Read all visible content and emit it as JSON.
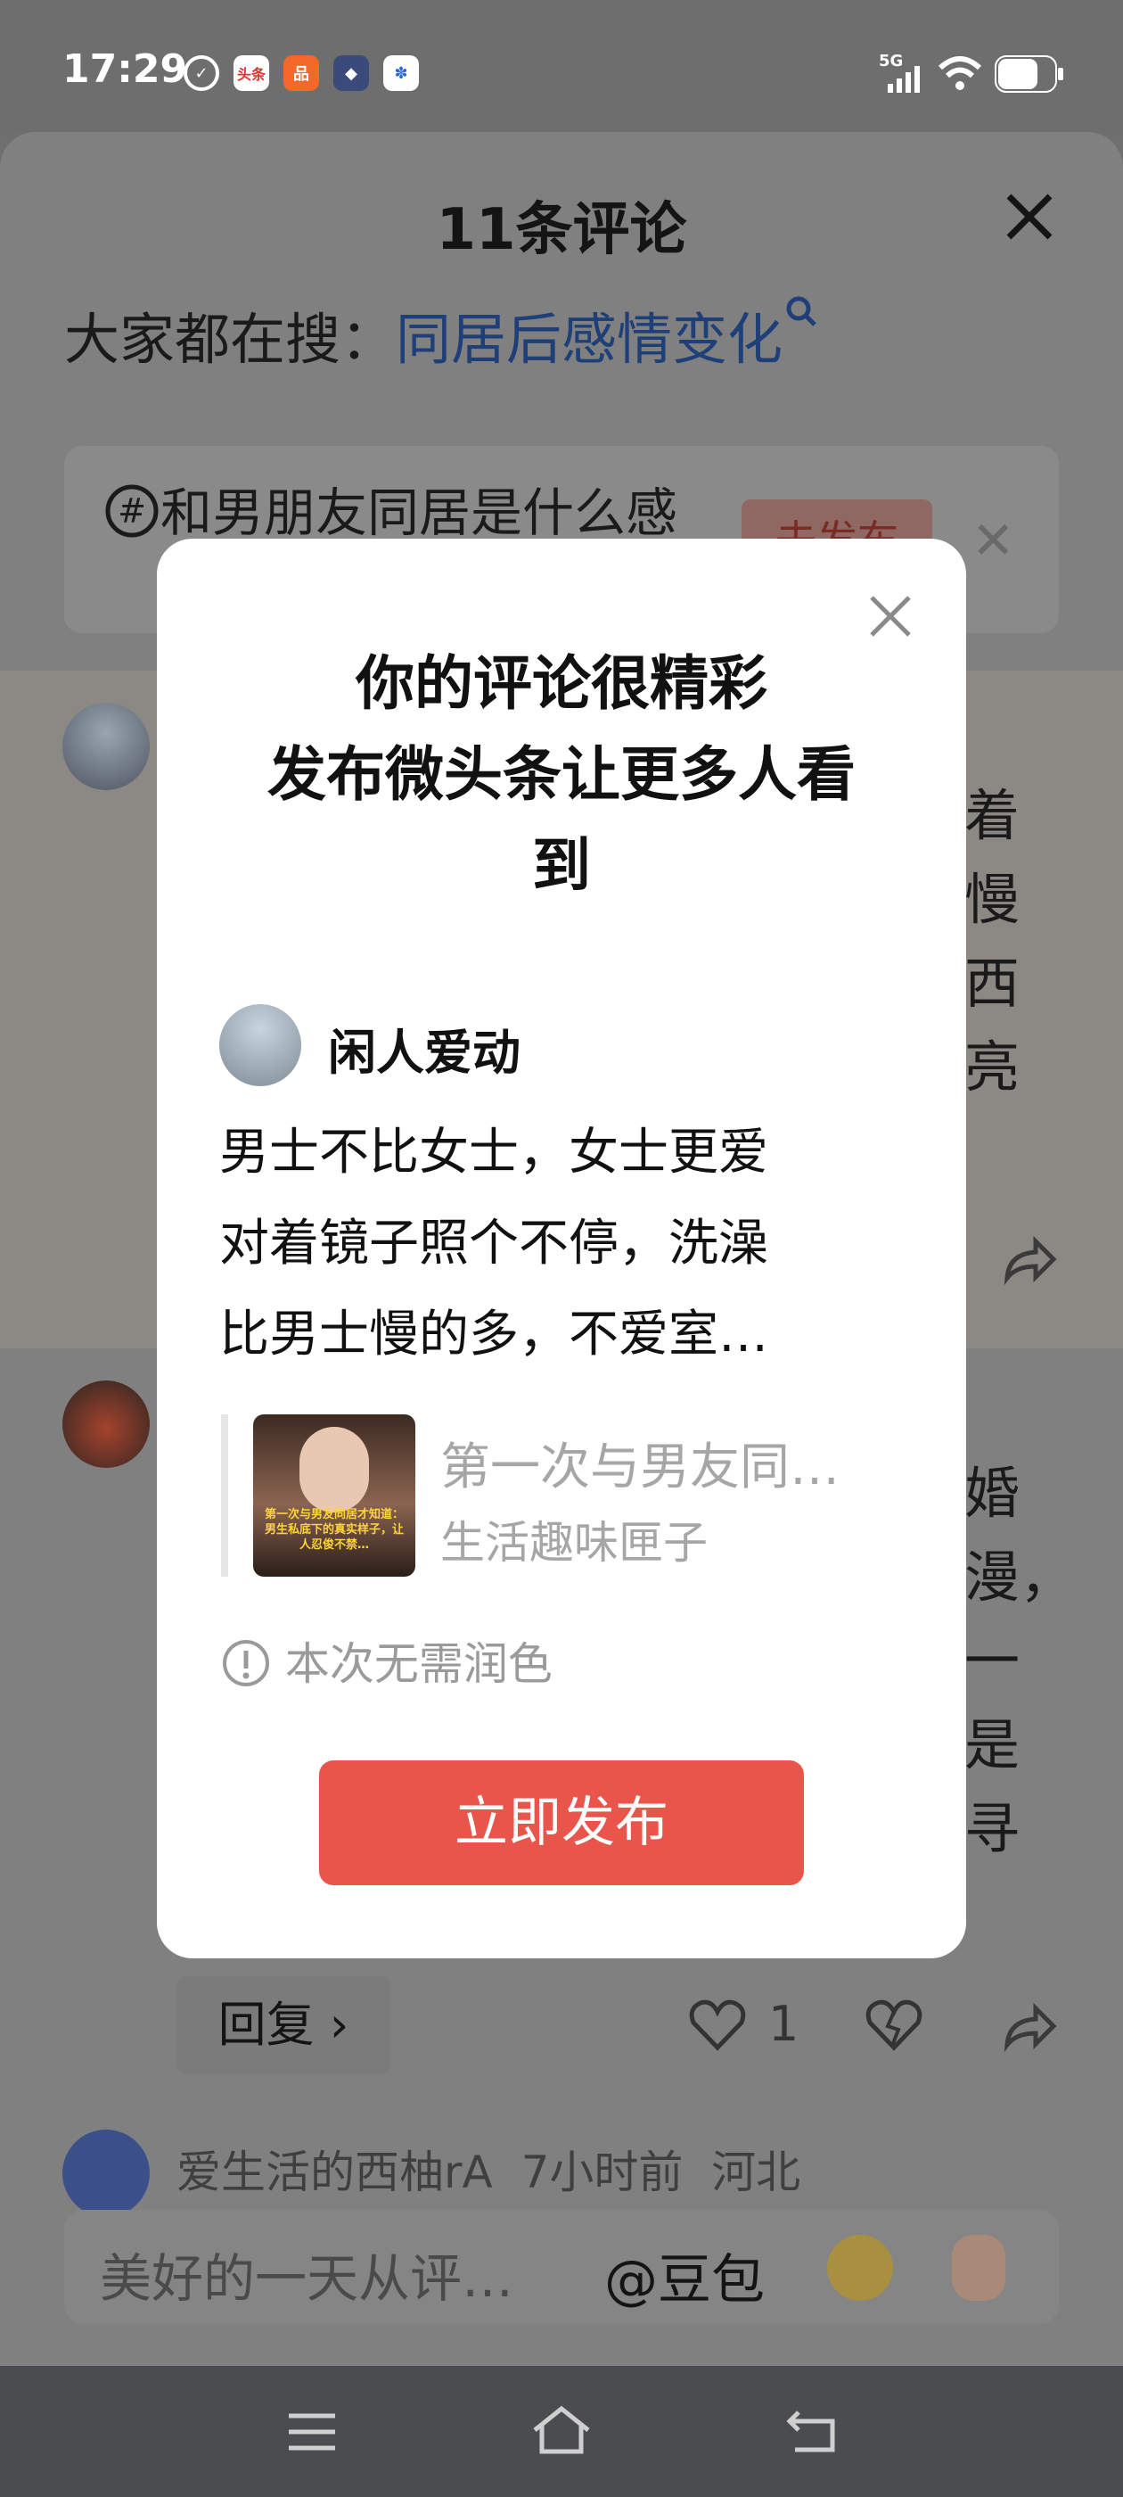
{
  "status_bar": {
    "time": "17:29",
    "network": "5G",
    "notification_icons": [
      "tick-circle-icon",
      "toutiao-app-icon",
      "app-orange-icon",
      "game-app-icon",
      "baidu-app-icon"
    ],
    "toutiao_label": "头条"
  },
  "sheet": {
    "title": "11条评论",
    "search_prefix": "大家都在搜：",
    "search_link": "同居后感情变化",
    "topic_text": "和男朋友同居是什么感",
    "topic_button": "去发布"
  },
  "comment_bg": {
    "fragments_top": [
      "着",
      "慢",
      "西",
      "亮"
    ],
    "fragments_mid": [
      "婚",
      "漫，",
      "一",
      "是",
      "寻"
    ],
    "reply_label": "回复",
    "like_count": "1",
    "next_comment_author": "爱生活的西柚rA",
    "next_comment_time": "7小时前",
    "next_comment_location": "河北"
  },
  "input_bar": {
    "placeholder": "美好的一天从评…",
    "mention": "@豆包"
  },
  "modal": {
    "title_lines": [
      "你的评论很精彩",
      "发布微头条让更多人看",
      "到"
    ],
    "author_name": "闲人爱动",
    "comment_lines": [
      "男士不比女士，女士更爱",
      "对着镜子照个不停，洗澡",
      "比男士慢的多，不爱室…"
    ],
    "article_title": "第一次与男友同…",
    "article_source": "生活趣味匣子",
    "thumbnail_caption": "第一次与男友同居才知道：男生私底下的真实样子，让人忍俊不禁…",
    "polish_notice": "本次无需润色",
    "publish_button": "立即发布"
  },
  "colors": {
    "accent_red": "#e9554a",
    "link_blue": "#1f3f79",
    "overlay": "#6f6f6f"
  }
}
